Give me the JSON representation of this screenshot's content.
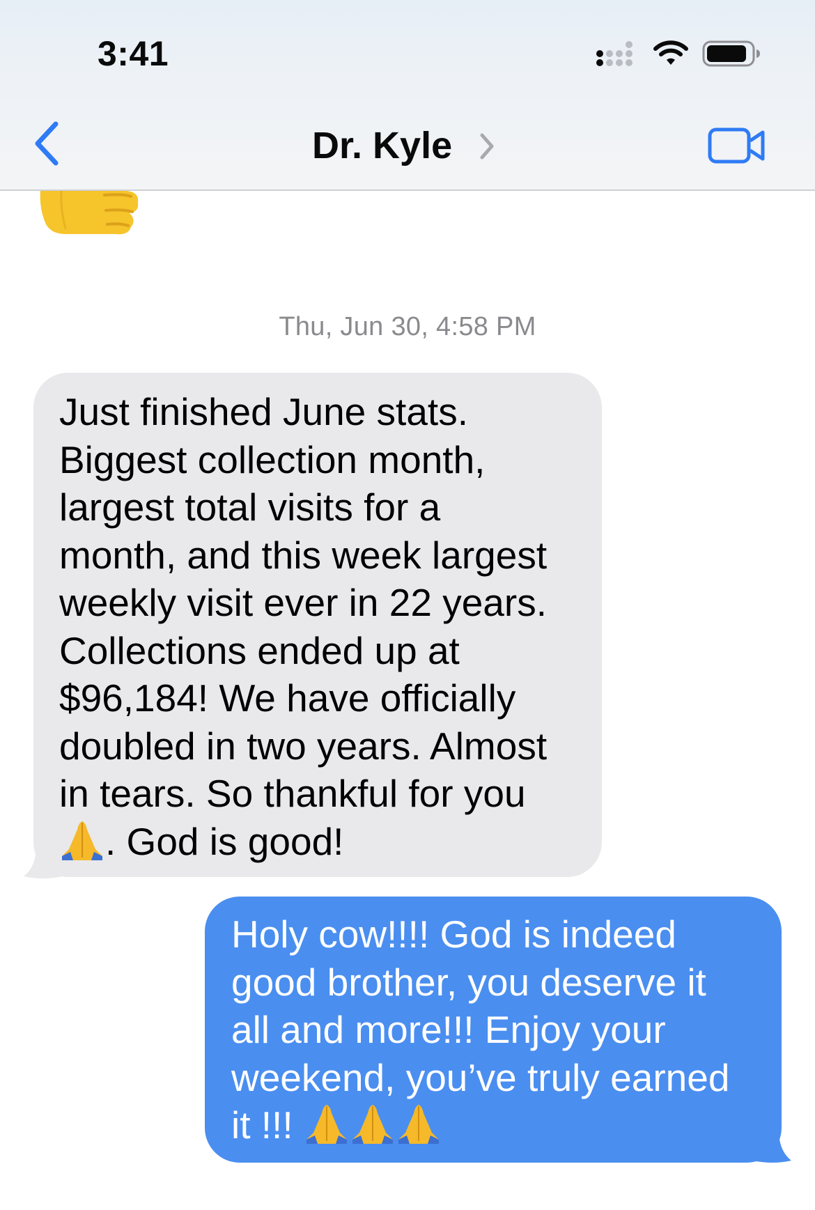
{
  "status_bar": {
    "time": "3:41"
  },
  "header": {
    "contact_name": "Dr. Kyle"
  },
  "conversation": {
    "timestamp": "Thu, Jun 30, 4:58 PM",
    "messages": [
      {
        "direction": "received",
        "lines": [
          "Just finished June stats.",
          "Biggest collection month,",
          "largest total visits for a",
          "month, and this week largest",
          "weekly visit ever in 22 years.",
          "Collections ended up at",
          "$96,184! We have officially",
          "doubled in two years. Almost",
          "in tears. So thankful for you"
        ],
        "last_line_text": ". God is good!"
      },
      {
        "direction": "sent",
        "lines": [
          "Holy cow!!!! God is indeed",
          "good brother, you deserve it",
          "all and more!!! Enjoy your",
          "weekend, you’ve truly earned"
        ],
        "last_line_text": "it !!! "
      }
    ]
  },
  "colors": {
    "received_bubble": "#e9e9eb",
    "sent_bubble": "#4a8ef0",
    "accent": "#2f7bf5"
  },
  "icons": [
    "signal-icon",
    "wifi-icon",
    "battery-icon",
    "back-chevron-icon",
    "chevron-right-icon",
    "video-camera-icon",
    "thumbs-up-emoji",
    "pray-icon"
  ]
}
